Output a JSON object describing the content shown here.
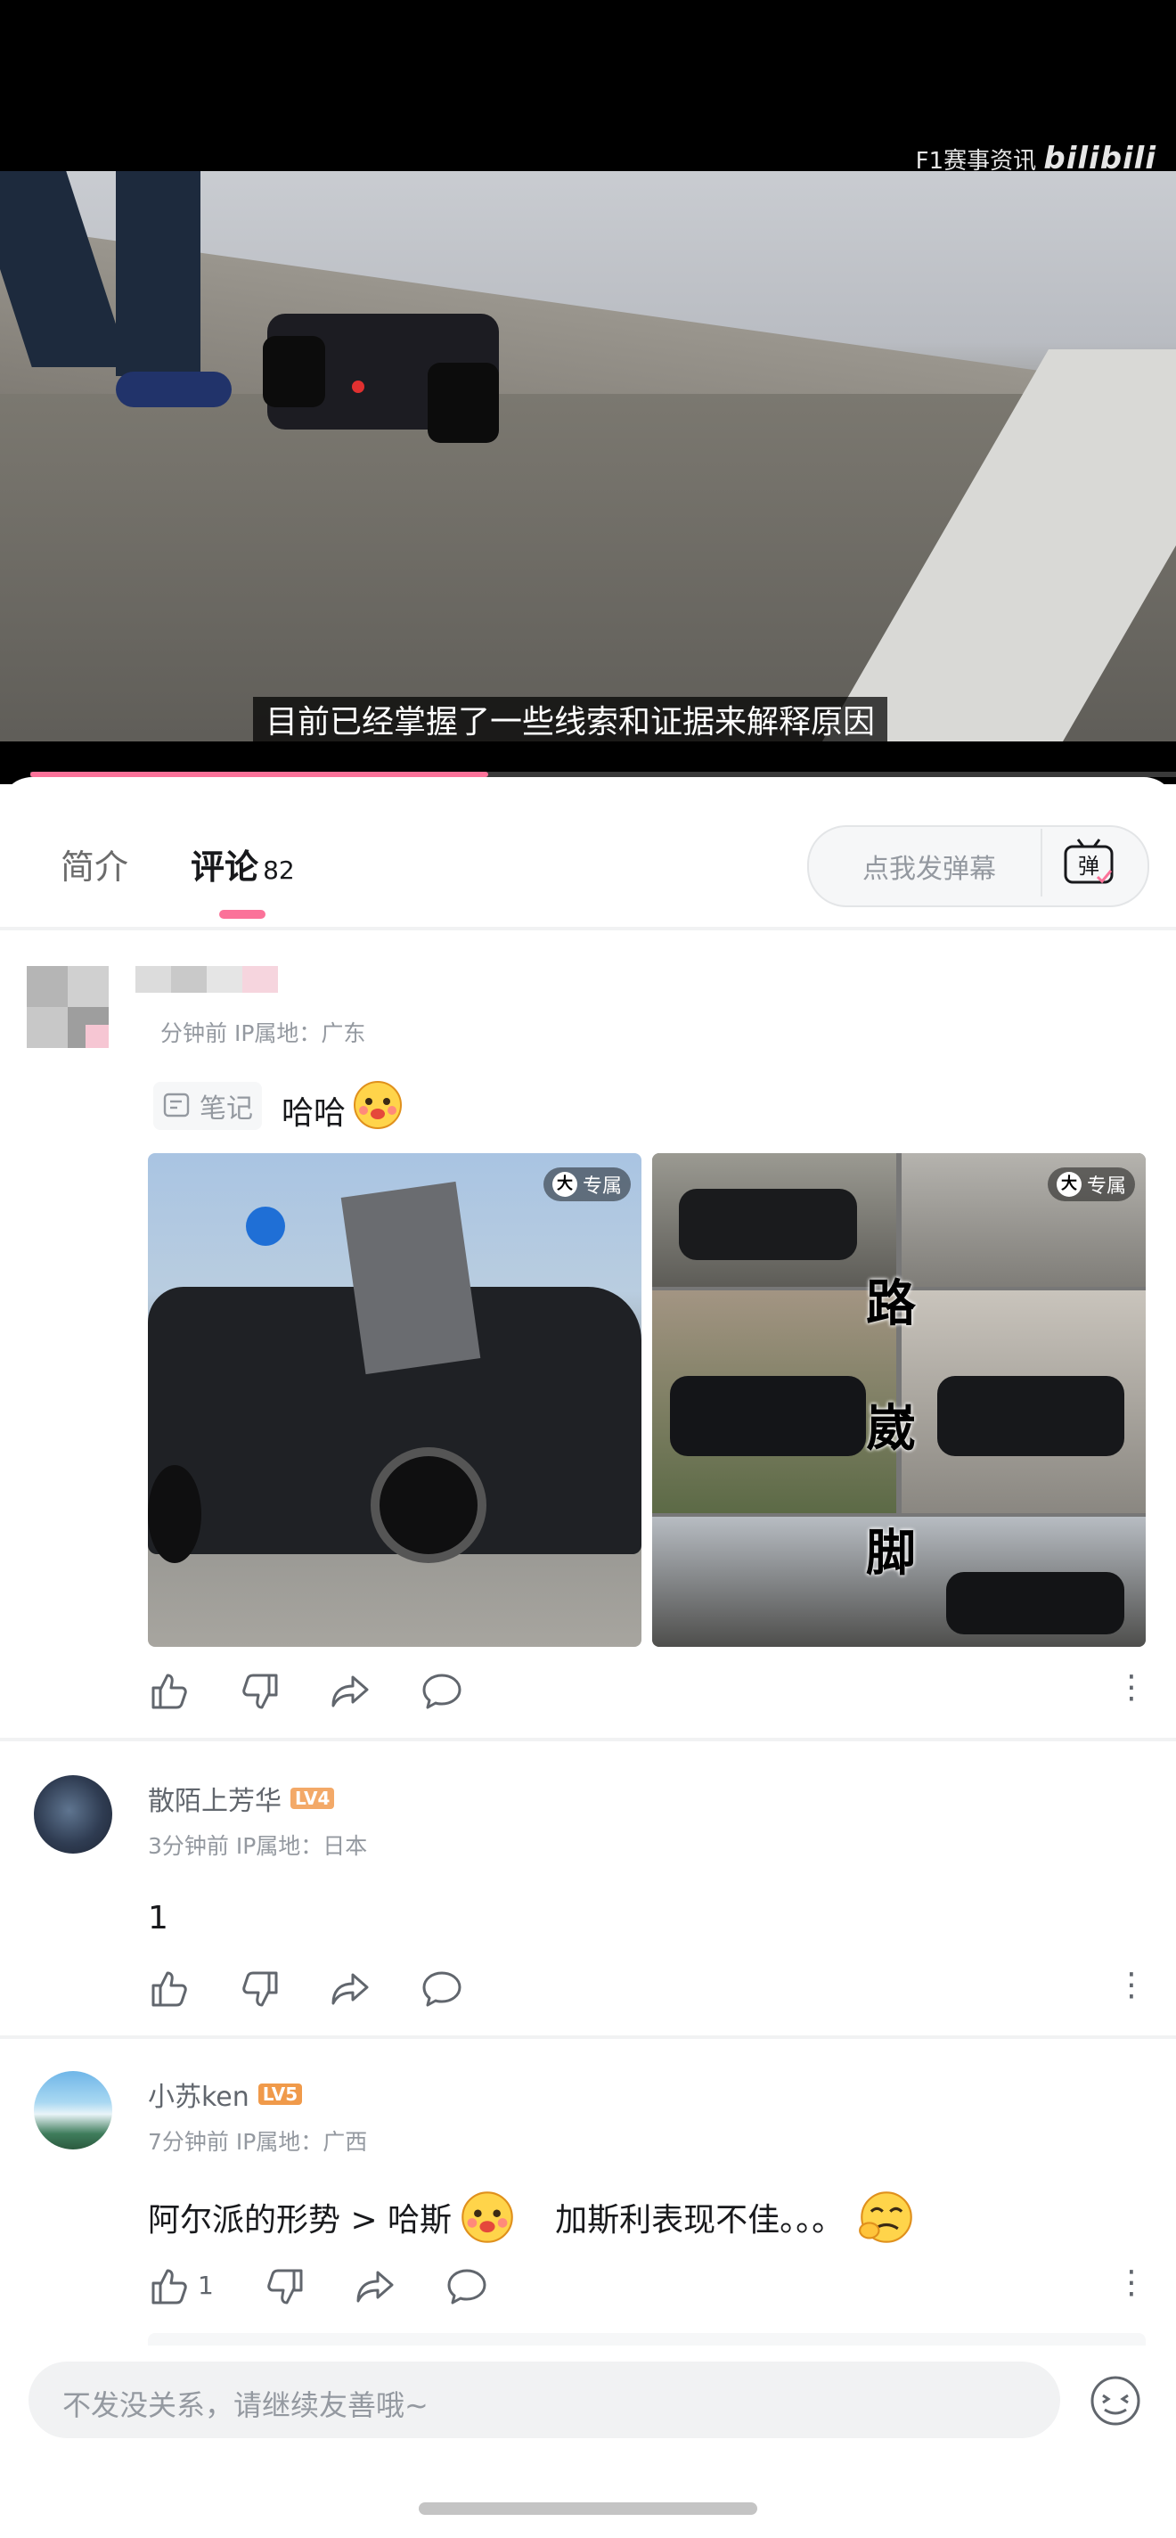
{
  "video": {
    "watermark_text": "F1赛事资讯",
    "watermark_logo": "bilibili",
    "subtitle": "目前已经掌握了一些线索和证据来解释原因",
    "progress_fraction": 0.4
  },
  "tabs": {
    "intro": "简介",
    "comments": "评论",
    "comments_count": "82"
  },
  "danmaku": {
    "placeholder": "点我发弹幕",
    "icon_char": "弹"
  },
  "comments": [
    {
      "user": "",
      "meta": "分钟前 IP属地：广东",
      "note_tag": "笔记",
      "text": "哈哈",
      "image_badge_1": "专属",
      "image_badge_2": "专属",
      "collage_chars": [
        "路",
        "崴",
        "脚"
      ]
    },
    {
      "user": "散陌上芳华",
      "level": "LV4",
      "meta": "3分钟前 IP属地：日本",
      "text": "1"
    },
    {
      "user": "小苏ken",
      "level": "LV5",
      "meta": "7分钟前 IP属地：广西",
      "text_a": "阿尔派的形势 > 哈斯",
      "text_b": "加斯利表现不佳。。。",
      "likes": "1"
    }
  ],
  "footer": {
    "input_placeholder": "不发没关系，请继续友善哦~"
  },
  "icons": [
    "like-icon",
    "dislike-icon",
    "share-icon",
    "reply-icon",
    "more-icon",
    "emoji-icon",
    "danmaku-icon",
    "note-icon"
  ],
  "colors": {
    "accent": "#fb7299",
    "level_badge": "#f3a968"
  }
}
